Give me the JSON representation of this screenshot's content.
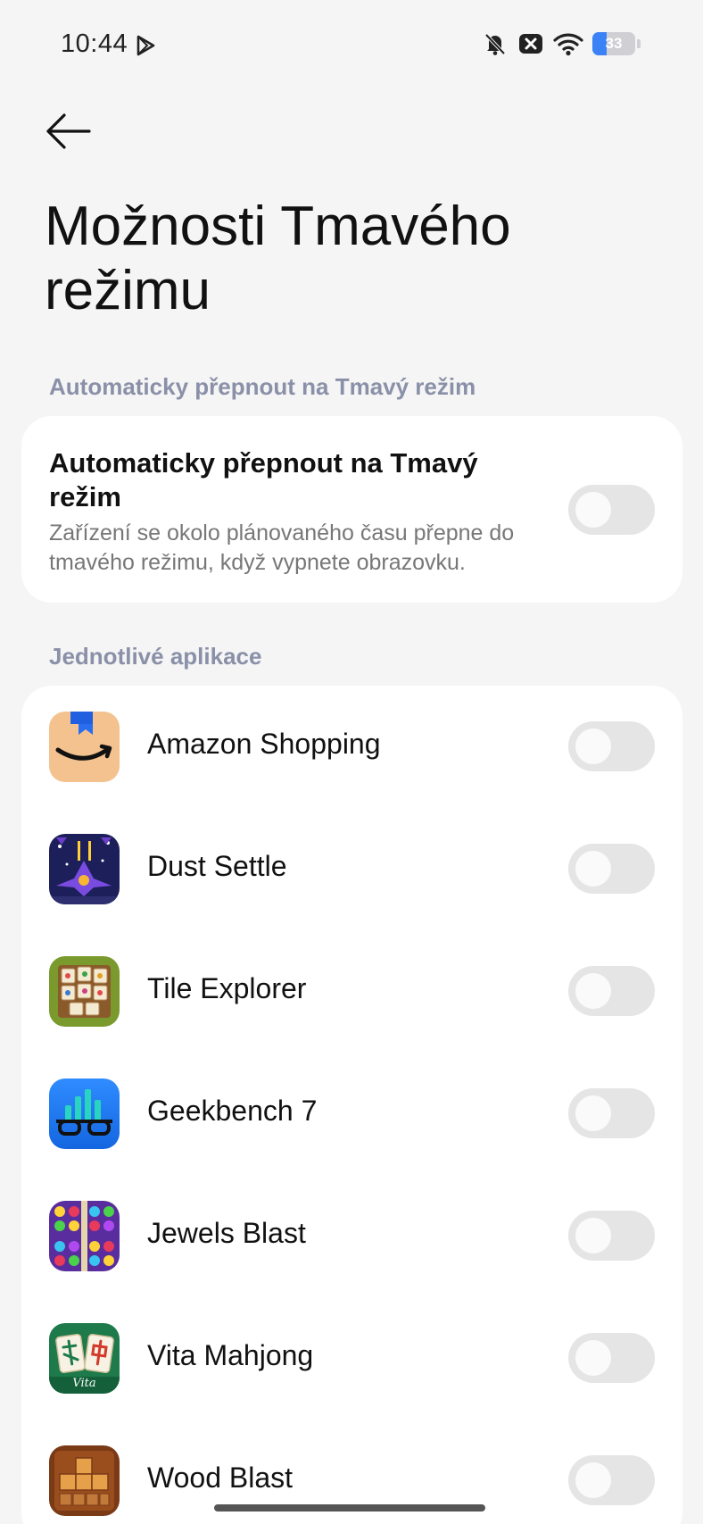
{
  "status_bar": {
    "time": "10:44",
    "battery_level": "33",
    "battery_fraction": 0.33,
    "icons": [
      "play-icon",
      "bell-off-icon",
      "close-box-icon",
      "wifi-icon",
      "battery-icon"
    ]
  },
  "header": {
    "back_icon": "arrow-left-icon",
    "title": "Možnosti Tmavého režimu"
  },
  "auto_section": {
    "header": "Automaticky přepnout na Tmavý režim",
    "item_title": "Automaticky přepnout na Tmavý režim",
    "item_description": "Zařízení se okolo plánovaného času přepne do tmavého režimu, když vypnete obrazovku.",
    "enabled": false
  },
  "apps_section": {
    "header": "Jednotlivé aplikace",
    "apps": [
      {
        "name": "Amazon Shopping",
        "icon": "amazon-icon",
        "enabled": false
      },
      {
        "name": "Dust Settle",
        "icon": "dust-settle-icon",
        "enabled": false
      },
      {
        "name": "Tile Explorer",
        "icon": "tile-explorer-icon",
        "enabled": false
      },
      {
        "name": "Geekbench 7",
        "icon": "geekbench-icon",
        "enabled": false
      },
      {
        "name": "Jewels Blast",
        "icon": "jewels-blast-icon",
        "enabled": false
      },
      {
        "name": "Vita Mahjong",
        "icon": "vita-mahjong-icon",
        "enabled": false
      },
      {
        "name": "Wood Blast",
        "icon": "wood-blast-icon",
        "enabled": false
      }
    ],
    "vita_icon_caption": "Vita"
  },
  "colors": {
    "background": "#f5f5f5",
    "card": "#ffffff",
    "section_header": "#8a90a8",
    "toggle_off": "#e5e5e5",
    "battery_fill": "#3b82f6"
  }
}
